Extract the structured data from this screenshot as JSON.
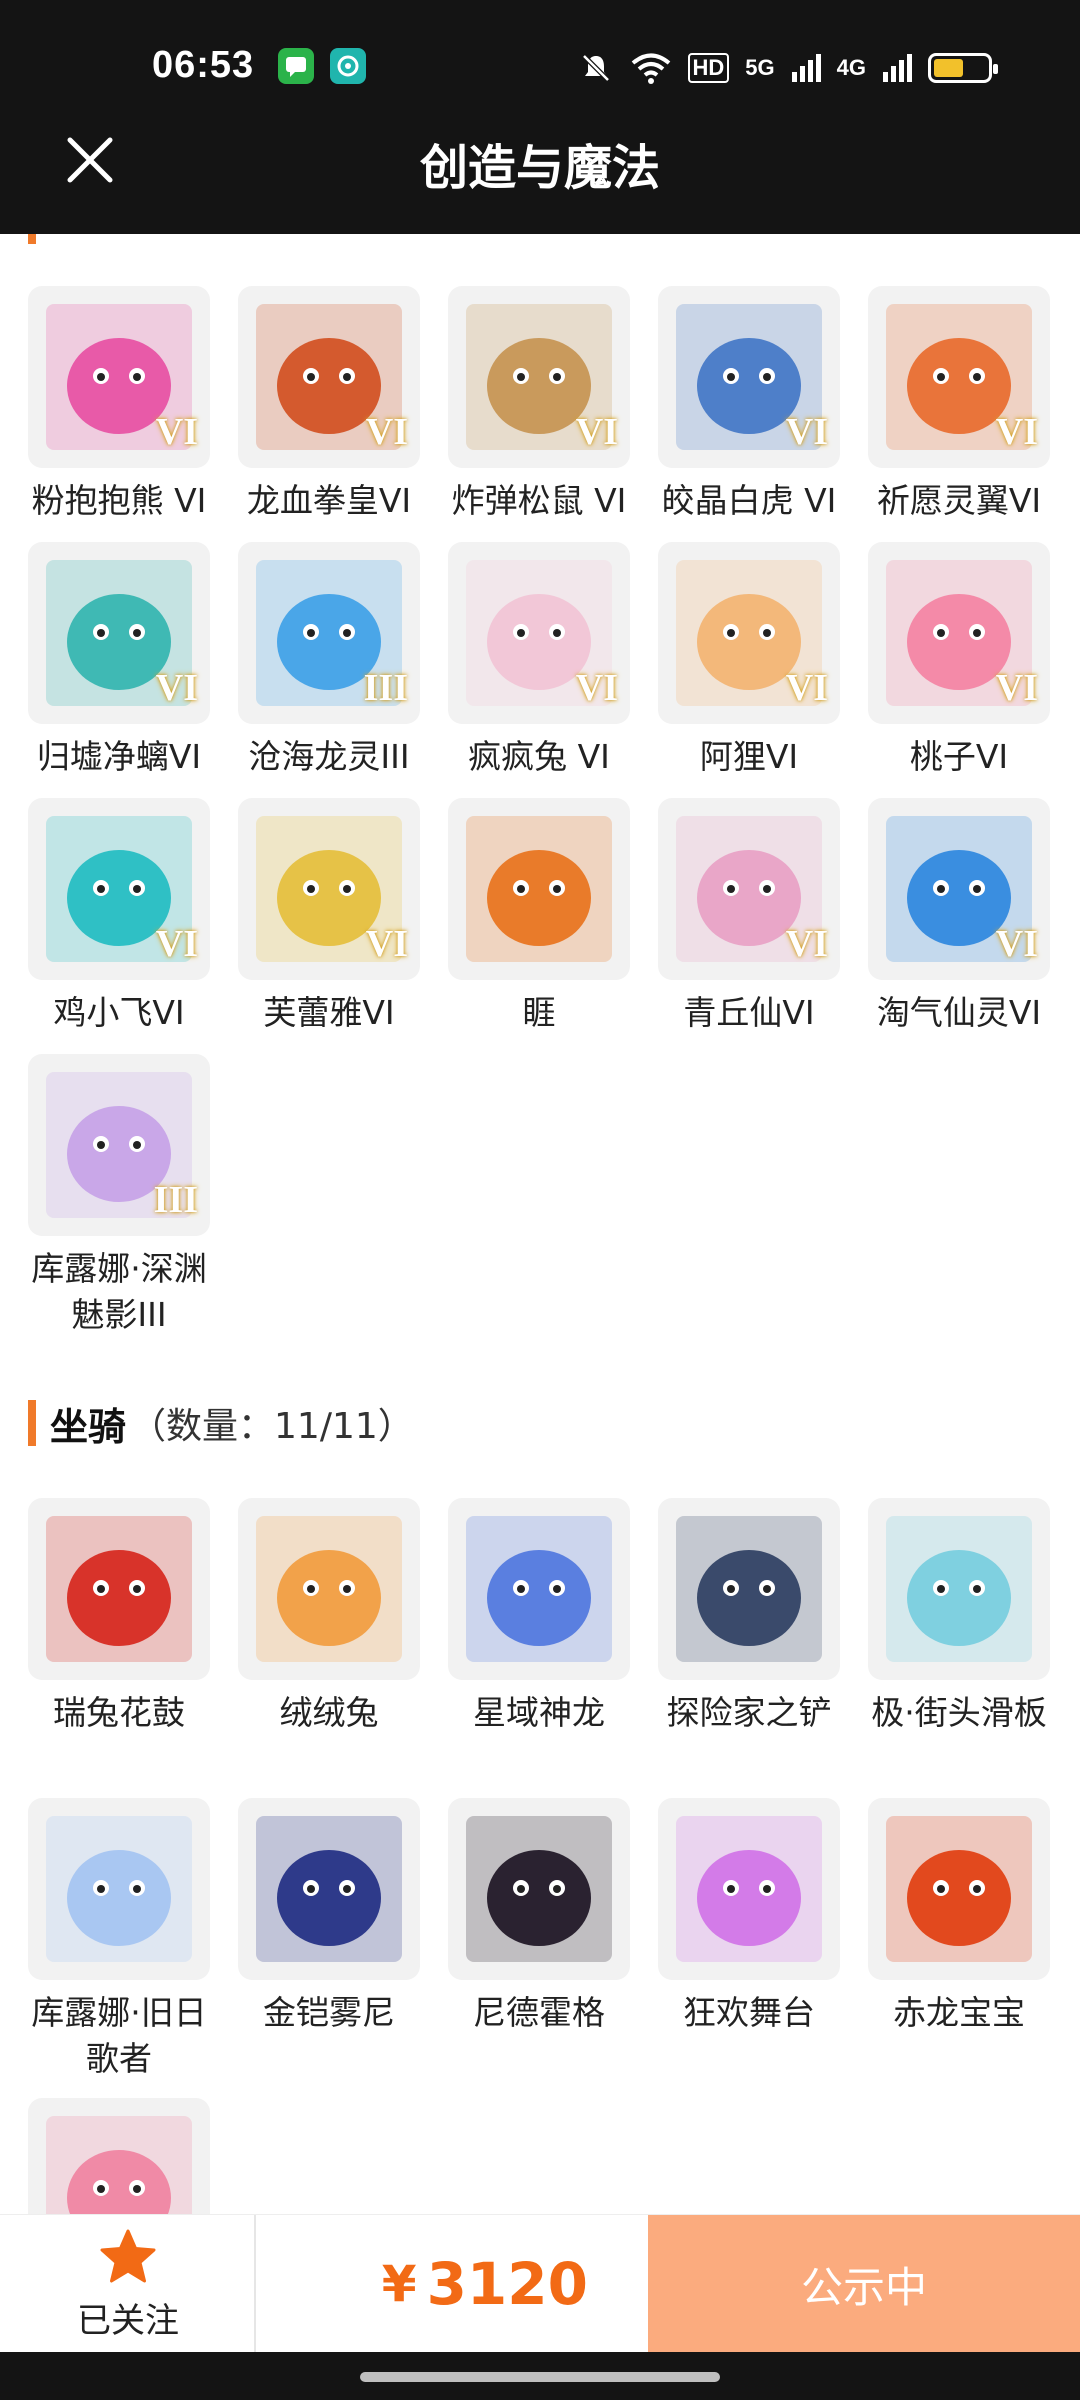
{
  "status_bar": {
    "time": "06:53",
    "hd_label": "HD",
    "net1": "5G",
    "net2": "4G",
    "battery_percent": 55
  },
  "header": {
    "title": "创造与魔法"
  },
  "pets": [
    {
      "label": "粉抱抱熊 VI",
      "badge": "VI",
      "color": "#e85aa8",
      "icon": "bear-pink-icon"
    },
    {
      "label": "龙血拳皇VI",
      "badge": "VI",
      "color": "#d45a2e",
      "icon": "dragon-boxer-icon"
    },
    {
      "label": "炸弹松鼠 VI",
      "badge": "VI",
      "color": "#c99a5c",
      "icon": "squirrel-icon"
    },
    {
      "label": "皎晶白虎 VI",
      "badge": "VI",
      "color": "#4e7fc9",
      "icon": "white-tiger-icon"
    },
    {
      "label": "祈愿灵翼VI",
      "badge": "VI",
      "color": "#e9743a",
      "icon": "wing-bird-icon"
    },
    {
      "label": "归墟净螭VI",
      "badge": "VI",
      "color": "#3fb9b4",
      "icon": "jade-dragon-icon"
    },
    {
      "label": "沧海龙灵III",
      "badge": "III",
      "color": "#4aa6e8",
      "icon": "sea-dragon-spirit-icon"
    },
    {
      "label": "疯疯兔 VI",
      "badge": "VI",
      "color": "#f2c7d7",
      "icon": "crazy-rabbit-icon"
    },
    {
      "label": "阿狸VI",
      "badge": "VI",
      "color": "#f3b87a",
      "icon": "ali-fox-icon"
    },
    {
      "label": "桃子VI",
      "badge": "VI",
      "color": "#f48aa8",
      "icon": "peach-cat-icon"
    },
    {
      "label": "鸡小飞VI",
      "badge": "VI",
      "color": "#2fc0c5",
      "icon": "chick-icon"
    },
    {
      "label": "芙蕾雅VI",
      "badge": "VI",
      "color": "#e6c247",
      "icon": "freya-icon"
    },
    {
      "label": "睚",
      "badge": "",
      "color": "#e97b2a",
      "icon": "yazi-dragon-icon"
    },
    {
      "label": "青丘仙VI",
      "badge": "VI",
      "color": "#e9a6c8",
      "icon": "fox-fairy-icon"
    },
    {
      "label": "淘气仙灵VI",
      "badge": "VI",
      "color": "#3a8ee0",
      "icon": "naughty-spirit-icon"
    },
    {
      "label": "库露娜·深渊魅影III",
      "badge": "III",
      "color": "#c9a7e8",
      "icon": "kuluna-abyss-icon"
    }
  ],
  "mounts_section": {
    "name": "坐骑",
    "count": "（数量：11/11）"
  },
  "mounts": [
    {
      "label": "瑞兔花鼓",
      "badge": "",
      "color": "#d8332a",
      "icon": "drum-icon"
    },
    {
      "label": "绒绒兔",
      "badge": "",
      "color": "#f2a24a",
      "icon": "fluffy-rabbit-icon"
    },
    {
      "label": "星域神龙",
      "badge": "",
      "color": "#5a7fe0",
      "icon": "star-dragon-icon"
    },
    {
      "label": "探险家之铲",
      "badge": "",
      "color": "#3a4a6b",
      "icon": "shovel-icon"
    },
    {
      "label": "极·街头滑板",
      "badge": "",
      "color": "#7fd0e0",
      "icon": "skateboard-icon"
    },
    {
      "label": "库露娜·旧日歌者",
      "badge": "",
      "color": "#a9c7f2",
      "icon": "kuluna-singer-icon"
    },
    {
      "label": "金铠雾尼",
      "badge": "",
      "color": "#2e3a8a",
      "icon": "armored-beast-icon"
    },
    {
      "label": "尼德霍格",
      "badge": "",
      "color": "#2a2230",
      "icon": "nidhogg-icon"
    },
    {
      "label": "狂欢舞台",
      "badge": "",
      "color": "#d37be8",
      "icon": "stage-icon"
    },
    {
      "label": "赤龙宝宝",
      "badge": "",
      "color": "#e2491e",
      "icon": "red-dragon-baby-icon"
    },
    {
      "label": "",
      "badge": "",
      "color": "#f08aa6",
      "icon": "candy-creature-icon"
    }
  ],
  "bottom": {
    "follow_label": "已关注",
    "currency": "¥",
    "price": "3120",
    "status_label": "公示中"
  },
  "colors": {
    "accent": "#f07a2a",
    "price": "#f26a15",
    "status_btn": "#fbab7e"
  }
}
